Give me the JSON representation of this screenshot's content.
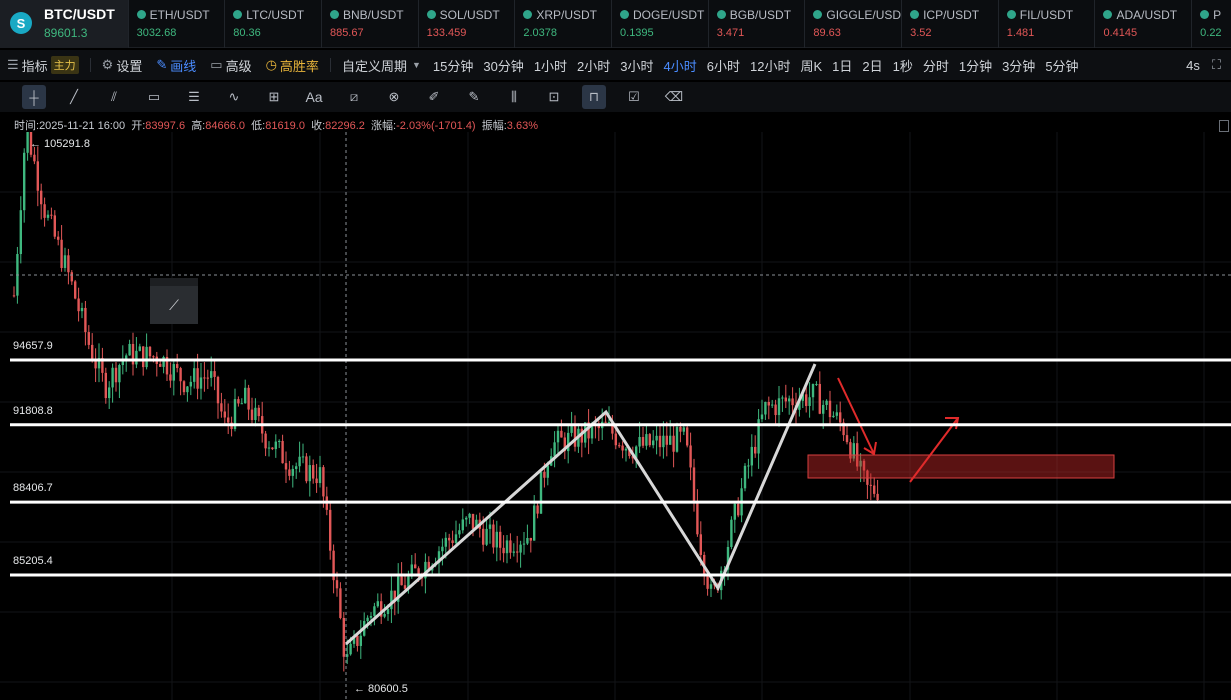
{
  "ticker": [
    {
      "symbol": "BTC/USDT",
      "price": "89601.3",
      "dir": "up",
      "primary": true
    },
    {
      "symbol": "ETH/USDT",
      "price": "3032.68",
      "dir": "up"
    },
    {
      "symbol": "LTC/USDT",
      "price": "80.36",
      "dir": "up"
    },
    {
      "symbol": "BNB/USDT",
      "price": "885.67",
      "dir": "dn"
    },
    {
      "symbol": "SOL/USDT",
      "price": "133.459",
      "dir": "dn"
    },
    {
      "symbol": "XRP/USDT",
      "price": "2.0378",
      "dir": "up"
    },
    {
      "symbol": "DOGE/USDT",
      "price": "0.1395",
      "dir": "up"
    },
    {
      "symbol": "BGB/USDT",
      "price": "3.471",
      "dir": "dn"
    },
    {
      "symbol": "GIGGLE/USDT",
      "price": "89.63",
      "dir": "dn"
    },
    {
      "symbol": "ICP/USDT",
      "price": "3.52",
      "dir": "dn"
    },
    {
      "symbol": "FIL/USDT",
      "price": "1.481",
      "dir": "dn"
    },
    {
      "symbol": "ADA/USDT",
      "price": "0.4145",
      "dir": "dn"
    },
    {
      "symbol": "P",
      "price": "0.22",
      "dir": "up"
    }
  ],
  "toolbar": {
    "indicator": "指标",
    "indicator_badge": "主力",
    "settings": "设置",
    "draw": "画线",
    "advanced": "高级",
    "winrate": "高胜率",
    "custom_period": "自定义周期",
    "periods": [
      "15分钟",
      "30分钟",
      "1小时",
      "2小时",
      "3小时",
      "4小时",
      "6小时",
      "12小时",
      "周K",
      "1日",
      "2日",
      "1秒",
      "分时",
      "1分钟",
      "3分钟",
      "5分钟"
    ],
    "active_period": "4小时",
    "refresh": "4s"
  },
  "info": {
    "time_label": "时间:",
    "time": "2025-11-21 16:00",
    "open_label": "开:",
    "open": "83997.6",
    "high_label": "高:",
    "high": "84666.0",
    "low_label": "低:",
    "low": "81619.0",
    "close_label": "收:",
    "close": "82296.2",
    "change_label": "涨幅:",
    "change": "-2.03%(-1701.4)",
    "amp_label": "振幅:",
    "amp": "3.63%"
  },
  "levels": [
    "94657.9",
    "91808.8",
    "88406.7",
    "85205.4"
  ],
  "high_marker": "← 105291.8",
  "low_marker": "← 80600.5",
  "colors": {
    "up": "#3fb87f",
    "down": "#e25757",
    "line": "#ffffff",
    "accent": "#4a8cff"
  }
}
